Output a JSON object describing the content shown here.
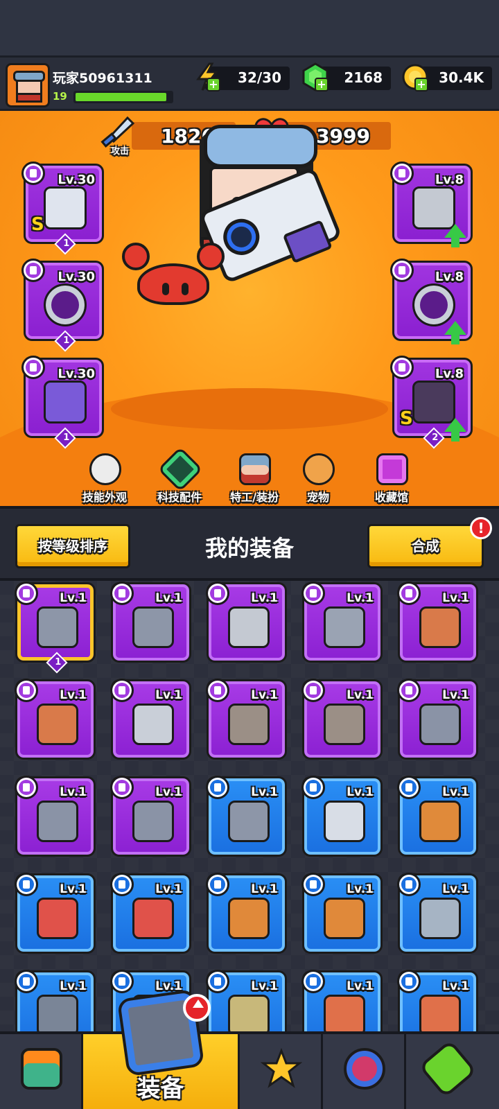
{
  "player": {
    "name": "玩家50961311",
    "level": "19",
    "xp_progress": 0.95
  },
  "resources": [
    {
      "name": "energy",
      "icon": "lightning-icon",
      "value": "32/30"
    },
    {
      "name": "gems",
      "icon": "gem-icon",
      "value": "2168"
    },
    {
      "name": "coins",
      "icon": "coin-icon",
      "value": "30.4K"
    }
  ],
  "stats": {
    "attack": {
      "label": "攻击",
      "value": "1826"
    },
    "health": {
      "label": "生命",
      "value": "3999"
    }
  },
  "equipped_left": [
    {
      "level": "Lv.30",
      "qty": "1",
      "grade": "S",
      "item": "blaster-gun"
    },
    {
      "level": "Lv.30",
      "qty": "1",
      "grade": "",
      "item": "spiked-collar"
    },
    {
      "level": "Lv.30",
      "qty": "1",
      "grade": "",
      "item": "tech-gauntlet"
    }
  ],
  "equipped_right": [
    {
      "level": "Lv.8",
      "qty": "",
      "grade": "",
      "item": "armor-vest",
      "upgrade": true
    },
    {
      "level": "Lv.8",
      "qty": "",
      "grade": "",
      "item": "star-belt",
      "upgrade": true
    },
    {
      "level": "Lv.8",
      "qty": "2",
      "grade": "S",
      "item": "armored-boot",
      "upgrade": true
    }
  ],
  "menu": [
    {
      "label": "技能外观",
      "icon": "skill-skin-icon"
    },
    {
      "label": "科技配件",
      "icon": "tech-part-icon"
    },
    {
      "label": "特工/装扮",
      "icon": "agent-costume-icon"
    },
    {
      "label": "宠物",
      "icon": "pet-icon"
    },
    {
      "label": "收藏馆",
      "icon": "collection-icon"
    }
  ],
  "inventory_header": {
    "sort_label": "按等级排序",
    "title": "我的装备",
    "merge_label": "合成",
    "alert": "!"
  },
  "inventory": [
    {
      "level": "Lv.1",
      "rarity": "purple",
      "item": "kunai",
      "qty": "1",
      "selected": true
    },
    {
      "level": "Lv.1",
      "rarity": "purple",
      "item": "kunai"
    },
    {
      "level": "Lv.1",
      "rarity": "purple",
      "item": "armor-vest"
    },
    {
      "level": "Lv.1",
      "rarity": "purple",
      "item": "chest-plate"
    },
    {
      "level": "Lv.1",
      "rarity": "purple",
      "item": "fang-necklace"
    },
    {
      "level": "Lv.1",
      "rarity": "purple",
      "item": "fang-necklace"
    },
    {
      "level": "Lv.1",
      "rarity": "purple",
      "item": "star-belt"
    },
    {
      "level": "Lv.1",
      "rarity": "purple",
      "item": "gem-belt"
    },
    {
      "level": "Lv.1",
      "rarity": "purple",
      "item": "gem-belt"
    },
    {
      "level": "Lv.1",
      "rarity": "purple",
      "item": "gauntlet"
    },
    {
      "level": "Lv.1",
      "rarity": "purple",
      "item": "gauntlet"
    },
    {
      "level": "Lv.1",
      "rarity": "purple",
      "item": "gauntlet"
    },
    {
      "level": "Lv.1",
      "rarity": "blue",
      "item": "kunai"
    },
    {
      "level": "Lv.1",
      "rarity": "blue",
      "item": "machete"
    },
    {
      "level": "Lv.1",
      "rarity": "blue",
      "item": "baseball-bat"
    },
    {
      "level": "Lv.1",
      "rarity": "blue",
      "item": "red-vest"
    },
    {
      "level": "Lv.1",
      "rarity": "blue",
      "item": "red-vest"
    },
    {
      "level": "Lv.1",
      "rarity": "blue",
      "item": "leather-jacket"
    },
    {
      "level": "Lv.1",
      "rarity": "blue",
      "item": "leather-jacket"
    },
    {
      "level": "Lv.1",
      "rarity": "blue",
      "item": "steel-armor"
    },
    {
      "level": "Lv.1",
      "rarity": "blue",
      "item": "belt"
    },
    {
      "level": "Lv.1",
      "rarity": "blue",
      "item": "belt"
    },
    {
      "level": "Lv.1",
      "rarity": "blue",
      "item": "khaki-shirt"
    },
    {
      "level": "Lv.1",
      "rarity": "blue",
      "item": "rope-necklace"
    },
    {
      "level": "Lv.1",
      "rarity": "blue",
      "item": "rope-necklace"
    }
  ],
  "tabs": [
    {
      "name": "shop",
      "icon": "shop-icon",
      "label": ""
    },
    {
      "name": "equipment",
      "icon": "equipment-icon",
      "label": "装备",
      "active": true
    },
    {
      "name": "battle",
      "icon": "battle-star-icon",
      "label": ""
    },
    {
      "name": "talent",
      "icon": "star-ball-icon",
      "label": ""
    },
    {
      "name": "evolve",
      "icon": "dna-capsule-icon",
      "label": ""
    }
  ],
  "colors": {
    "purple": "#9b2ddb",
    "blue": "#1f7fe8",
    "accent": "#ffc62a",
    "upgrade": "#37c946"
  }
}
